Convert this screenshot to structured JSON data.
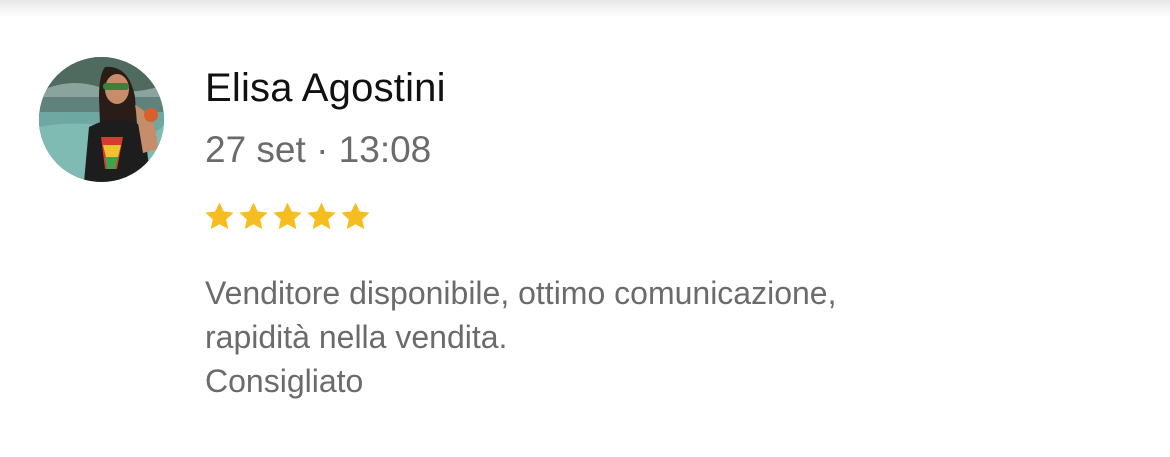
{
  "review": {
    "reviewer_name": "Elisa Agostini",
    "timestamp": "27 set · 13:08",
    "rating": 5,
    "rating_max": 5,
    "star_color": "#F5BE1E",
    "avatar_icon": "avatar-photo",
    "text_lines": [
      "Venditore disponibile, ottimo comunicazione,",
      "rapidità nella vendita.",
      "Consigliato"
    ]
  }
}
